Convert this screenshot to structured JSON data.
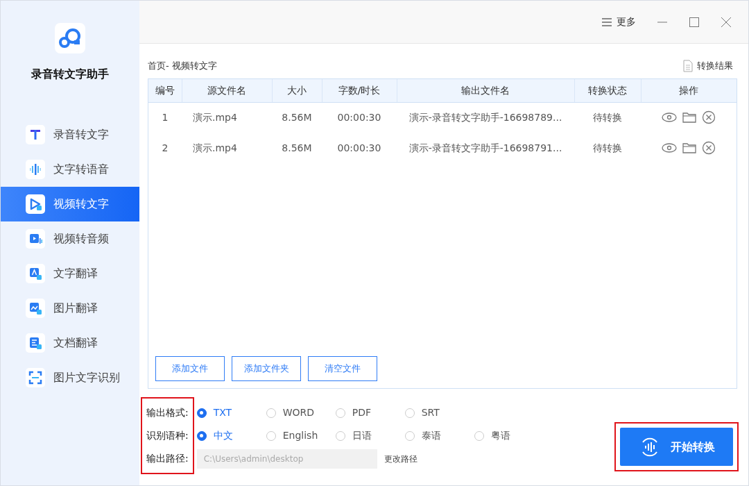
{
  "app": {
    "title": "录音转文字助手"
  },
  "sidebar": {
    "items": [
      {
        "label": "录音转文字",
        "kind": "text",
        "selected": false
      },
      {
        "label": "文字转语音",
        "kind": "wave",
        "selected": false
      },
      {
        "label": "视频转文字",
        "kind": "video-text",
        "selected": true
      },
      {
        "label": "视频转音频",
        "kind": "video-audio",
        "selected": false
      },
      {
        "label": "文字翻译",
        "kind": "translate-text",
        "selected": false
      },
      {
        "label": "图片翻译",
        "kind": "translate-image",
        "selected": false
      },
      {
        "label": "文档翻译",
        "kind": "translate-doc",
        "selected": false
      },
      {
        "label": "图片文字识别",
        "kind": "scan",
        "selected": false
      }
    ]
  },
  "topbar": {
    "more": "更多"
  },
  "breadcrumb": "首页- 视频转文字",
  "results_link": "转换结果",
  "table": {
    "columns": [
      "编号",
      "源文件名",
      "大小",
      "字数/时长",
      "输出文件名",
      "转换状态",
      "操作"
    ],
    "rows": [
      {
        "index": "1",
        "source": "演示.mp4",
        "size": "8.56M",
        "duration": "00:00:30",
        "output": "演示-录音转文字助手-16698789...",
        "status": "待转换"
      },
      {
        "index": "2",
        "source": "演示.mp4",
        "size": "8.56M",
        "duration": "00:00:30",
        "output": "演示-录音转文字助手-16698791...",
        "status": "待转换"
      }
    ]
  },
  "file_buttons": [
    "添加文件",
    "添加文件夹",
    "清空文件"
  ],
  "settings": {
    "highlighted": true,
    "format": {
      "label": "输出格式:",
      "options": [
        {
          "label": "TXT",
          "selected": true
        },
        {
          "label": "WORD",
          "selected": false
        },
        {
          "label": "PDF",
          "selected": false
        },
        {
          "label": "SRT",
          "selected": false
        }
      ]
    },
    "language": {
      "label": "识别语种:",
      "options": [
        {
          "label": "中文",
          "selected": true
        },
        {
          "label": "English",
          "selected": false
        },
        {
          "label": "日语",
          "selected": false
        },
        {
          "label": "泰语",
          "selected": false
        },
        {
          "label": "粤语",
          "selected": false
        }
      ]
    },
    "path": {
      "label": "输出路径:",
      "placeholder": "C:\\Users\\admin\\desktop",
      "change": "更改路径"
    }
  },
  "start_button": {
    "label": "开始转换",
    "highlighted": true
  }
}
